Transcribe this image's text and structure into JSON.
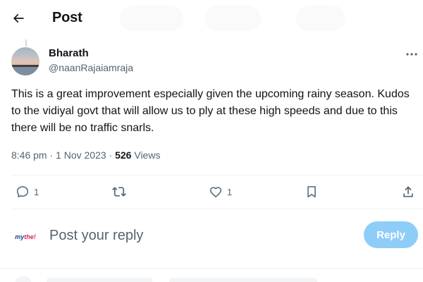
{
  "header": {
    "title": "Post"
  },
  "tweet": {
    "author_name": "Bharath",
    "author_handle": "@naanRajaiamraja",
    "text": "This is a great improvement especially given the upcoming rainy season. Kudos to the vidiyal govt that will allow us to ply at these high speeds and due to this there will be no traffic snarls.",
    "time": "8:46 pm",
    "date": "1 Nov 2023",
    "views_count": "526",
    "views_label": "Views"
  },
  "actions": {
    "reply_count": "1",
    "like_count": "1"
  },
  "reply_box": {
    "avatar_text_a": "my",
    "avatar_text_b": "the!",
    "placeholder": "Post your reply",
    "button_label": "Reply"
  },
  "icons": [
    "back-arrow-icon",
    "more-icon",
    "reply-icon",
    "retweet-icon",
    "like-icon",
    "bookmark-icon",
    "share-icon"
  ],
  "colors": {
    "reply_button": "#8ecdf8",
    "secondary_text": "#536471",
    "divider": "#eff3f4"
  }
}
